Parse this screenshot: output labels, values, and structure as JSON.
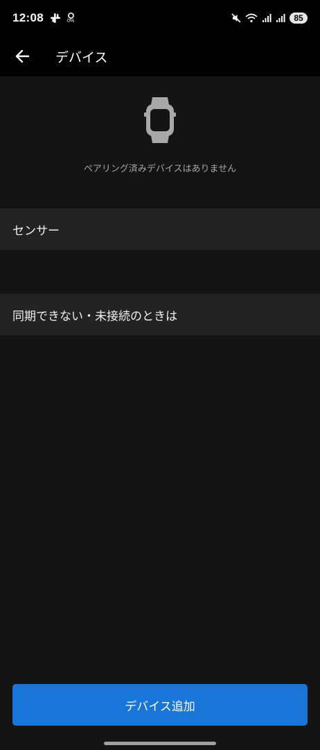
{
  "status_bar": {
    "time": "12:08",
    "data_rate": "0%",
    "battery": "85",
    "icons": [
      "slack-icon",
      "sync-icon",
      "mute-icon",
      "wifi-icon",
      "signal-icon",
      "signal-icon"
    ]
  },
  "app_bar": {
    "back_icon": "arrow-left-icon",
    "title": "デバイス"
  },
  "empty_state": {
    "icon": "smartwatch-icon",
    "message": "ペアリング済みデバイスはありません"
  },
  "sections": {
    "sensor_label": "センサー",
    "help_label": "同期できない・未接続のときは"
  },
  "footer": {
    "add_button_label": "デバイス追加",
    "accent_color": "#1976d8"
  }
}
